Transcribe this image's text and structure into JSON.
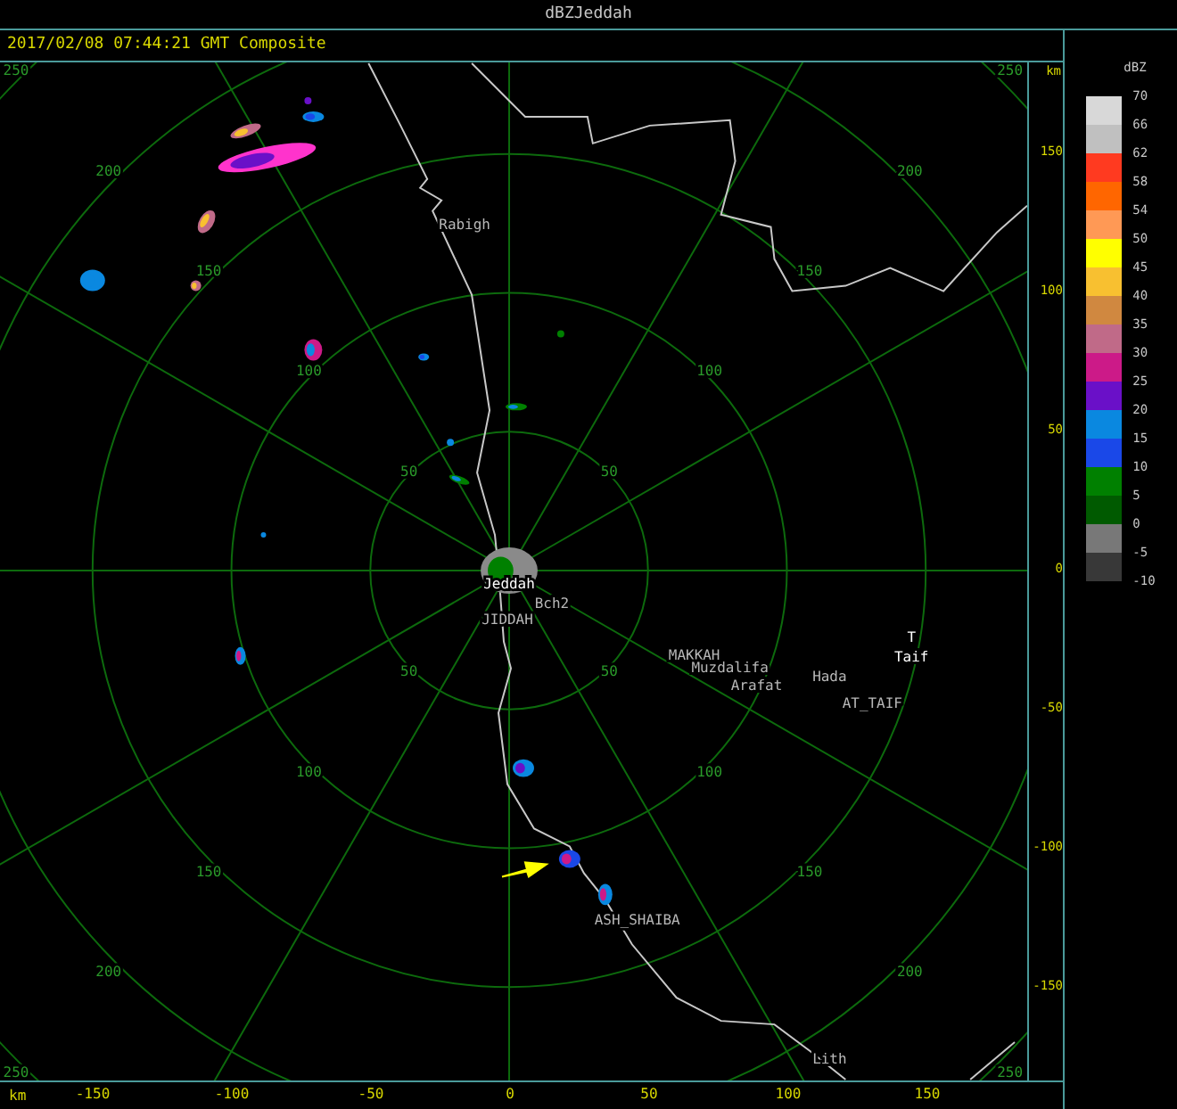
{
  "window": {
    "title": "dBZJeddah"
  },
  "header": {
    "timestamp": "2017/02/08 07:44:21 GMT Composite"
  },
  "plot": {
    "rings": [
      {
        "labels": [
          "50",
          "50",
          "50",
          "50"
        ]
      },
      {
        "labels": [
          "100",
          "100",
          "100",
          "100"
        ]
      },
      {
        "labels": [
          "150",
          "150",
          "150",
          "150"
        ]
      },
      {
        "labels": [
          "200",
          "200",
          "200",
          "200"
        ]
      },
      {
        "labels": [
          "250",
          "250",
          "250",
          "250"
        ]
      }
    ],
    "places": [
      {
        "name": "Rabigh",
        "kind": "minor"
      },
      {
        "name": "Jeddah",
        "kind": "major"
      },
      {
        "name": "Bch2",
        "kind": "minor"
      },
      {
        "name": "JIDDAH",
        "kind": "minor"
      },
      {
        "name": "MAKKAH",
        "kind": "minor"
      },
      {
        "name": "Muzdalifa",
        "kind": "minor"
      },
      {
        "name": "Arafat",
        "kind": "minor"
      },
      {
        "name": "Hada",
        "kind": "minor"
      },
      {
        "name": "T",
        "kind": "major"
      },
      {
        "name": "Taif",
        "kind": "major"
      },
      {
        "name": "AT_TAIF",
        "kind": "minor"
      },
      {
        "name": "ASH_SHAIBA",
        "kind": "minor"
      },
      {
        "name": "Lith",
        "kind": "minor"
      }
    ]
  },
  "y_axis": {
    "unit": "km",
    "ticks": [
      "150",
      "100",
      "50",
      "0",
      "-50",
      "-100",
      "-150"
    ]
  },
  "x_axis": {
    "unit": "km",
    "ticks": [
      "-150",
      "-100",
      "-50",
      "0",
      "50",
      "100",
      "150"
    ]
  },
  "legend": {
    "title": "dBZ",
    "bands": [
      {
        "label": "70",
        "color": "#d8d8d8"
      },
      {
        "label": "66",
        "color": "#c0c0c0"
      },
      {
        "label": "62",
        "color": "#ff3a20"
      },
      {
        "label": "58",
        "color": "#ff6600"
      },
      {
        "label": "54",
        "color": "#ff9955"
      },
      {
        "label": "50",
        "color": "#ffff00"
      },
      {
        "label": "45",
        "color": "#f8c030"
      },
      {
        "label": "40",
        "color": "#d08840"
      },
      {
        "label": "35",
        "color": "#c06a88"
      },
      {
        "label": "30",
        "color": "#cc1a88"
      },
      {
        "label": "25",
        "color": "#6a10c8"
      },
      {
        "label": "20",
        "color": "#0a88e0"
      },
      {
        "label": "15",
        "color": "#1a48e8"
      },
      {
        "label": "10",
        "color": "#008000"
      },
      {
        "label": "5",
        "color": "#005a00"
      },
      {
        "label": "0",
        "color": "#787878"
      },
      {
        "label": "-5",
        "color": "#383838"
      }
    ],
    "last_label": "-10"
  }
}
